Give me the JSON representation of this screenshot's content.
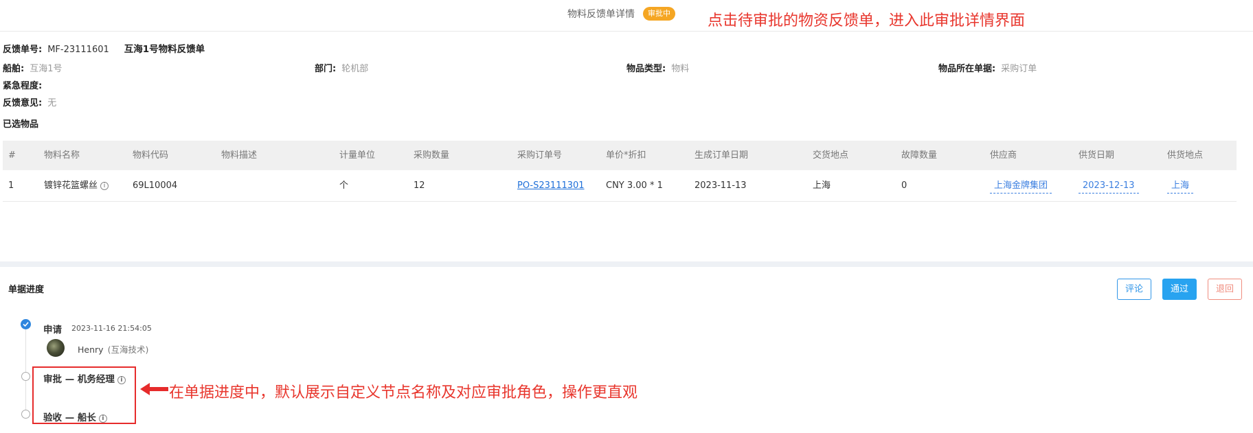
{
  "header": {
    "title": "物料反馈单详情",
    "status_badge": "审批中",
    "annotation": "点击待审批的物资反馈单，进入此审批详情界面"
  },
  "info": {
    "feedback_no_label": "反馈单号:",
    "feedback_no": "MF-23111601",
    "form_name": "互海1号物料反馈单",
    "vessel_label": "船舶:",
    "vessel": "互海1号",
    "dept_label": "部门:",
    "dept": "轮机部",
    "item_type_label": "物品类型:",
    "item_type": "物料",
    "source_doc_label": "物品所在单据:",
    "source_doc": "采购订单",
    "urgency_label": "紧急程度:",
    "urgency": "",
    "feedback_label": "反馈意见:",
    "feedback": "无"
  },
  "selected_items": {
    "title": "已选物品",
    "columns": [
      "#",
      "物料名称",
      "物料代码",
      "物料描述",
      "计量单位",
      "采购数量",
      "采购订单号",
      "单价*折扣",
      "生成订单日期",
      "交货地点",
      "故障数量",
      "供应商",
      "供货日期",
      "供货地点"
    ],
    "rows": [
      {
        "index": "1",
        "name": "镀锌花篮螺丝",
        "code": "69L10004",
        "desc": "",
        "unit": "个",
        "qty": "12",
        "po_no": "PO-S23111301",
        "price": "CNY  3.00 * 1",
        "order_date": "2023-11-13",
        "delivery_place": "上海",
        "fault_qty": "0",
        "supplier": "上海金牌集团",
        "supply_date": "2023-12-13",
        "supply_place": "上海"
      }
    ]
  },
  "progress": {
    "title": "单据进度",
    "buttons": {
      "comment": "评论",
      "approve": "通过",
      "return": "退回"
    },
    "steps": [
      {
        "name": "申请",
        "time": "2023-11-16 21:54:05",
        "user": "Henry",
        "org": "(互海技术)",
        "done": true
      },
      {
        "name": "审批 — 机务经理",
        "done": false
      },
      {
        "name": "验收 — 船长",
        "done": false
      }
    ],
    "annotation": "在单据进度中，默认展示自定义节点名称及对应审批角色，操作更直观"
  },
  "icons": {
    "info": "info-icon",
    "check": "check-icon",
    "arrow": "arrow-left-icon"
  },
  "colors": {
    "accent": "#28a3f0",
    "badge": "#f5a623",
    "annotation": "#e8362d",
    "return": "#f08c7e"
  }
}
